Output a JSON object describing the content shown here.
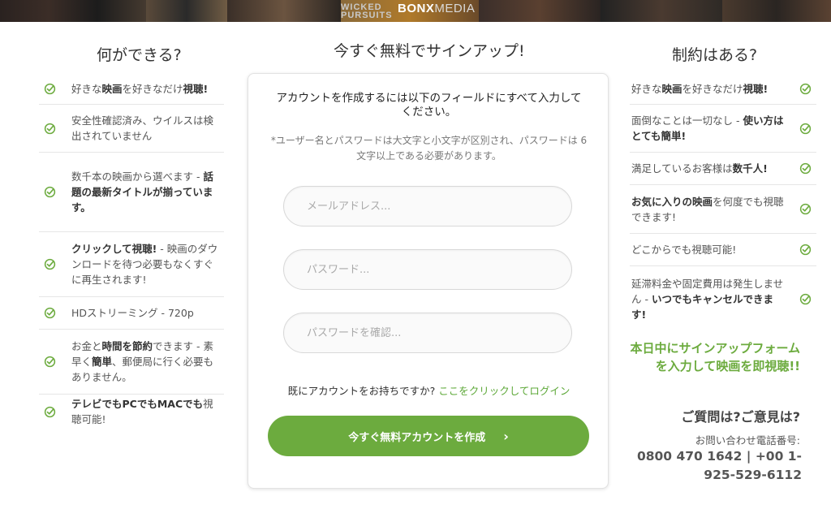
{
  "banner": {
    "brand": "BONX",
    "media": "MEDIA",
    "overlay_line1": "WICKED",
    "overlay_line2": "PURSUITS"
  },
  "left_column": {
    "title": "何ができる?",
    "items": [
      {
        "parts": [
          {
            "t": "好きな",
            "b": false
          },
          {
            "t": "映画",
            "b": true
          },
          {
            "t": "を好きなだけ",
            "b": false
          },
          {
            "t": "視聴!",
            "b": true
          }
        ]
      },
      {
        "parts": [
          {
            "t": "安全性確認済み、ウイルスは検出されていません",
            "b": false
          }
        ]
      },
      {
        "parts": [
          {
            "t": "数千本の映画から選べます - ",
            "b": false
          },
          {
            "t": "話題の最新タイトルが揃っています。",
            "b": true
          }
        ]
      },
      {
        "parts": [
          {
            "t": "クリックして視聴!",
            "b": true
          },
          {
            "t": " - 映画のダウンロードを待つ必要もなくすぐに再生されます!",
            "b": false
          }
        ]
      },
      {
        "parts": [
          {
            "t": "HDストリーミング - 720p",
            "b": false
          }
        ]
      },
      {
        "parts": [
          {
            "t": "お金と",
            "b": false
          },
          {
            "t": "時間を節約",
            "b": true
          },
          {
            "t": "できます - 素早く",
            "b": false
          },
          {
            "t": "簡単",
            "b": true
          },
          {
            "t": "、郵便局に行く必要もありません。",
            "b": false
          }
        ]
      },
      {
        "parts": [
          {
            "t": "テレビでもPCでもMACでも",
            "b": true
          },
          {
            "t": "視聴可能!",
            "b": false
          }
        ]
      }
    ]
  },
  "center": {
    "title": "今すぐ無料でサインアップ!",
    "heading": "アカウントを作成するには以下のフィールドにすべて入力してください。",
    "note": "*ユーザー名とパスワードは大文字と小文字が区別され、パスワードは 6 文字以上である必要があります。",
    "email_placeholder": "メールアドレス...",
    "password_placeholder": "パスワード...",
    "confirm_placeholder": "パスワードを確認...",
    "login_prompt": "既にアカウントをお持ちですか?",
    "login_link": "ここをクリックしてログイン",
    "cta_label": "今すぐ無料アカウントを作成",
    "cta_arrow": "›"
  },
  "right_column": {
    "title": "制約はある?",
    "items": [
      {
        "parts": [
          {
            "t": "好きな",
            "b": false
          },
          {
            "t": "映画",
            "b": true
          },
          {
            "t": "を好きなだけ",
            "b": false
          },
          {
            "t": "視聴!",
            "b": true
          }
        ]
      },
      {
        "parts": [
          {
            "t": "面倒なことは一切なし - ",
            "b": false
          },
          {
            "t": "使い方はとても簡単!",
            "b": true
          }
        ]
      },
      {
        "parts": [
          {
            "t": "満足しているお客様は",
            "b": false
          },
          {
            "t": "数千人!",
            "b": true
          }
        ]
      },
      {
        "parts": [
          {
            "t": "お気に入りの映画",
            "b": true
          },
          {
            "t": "を何度でも視聴できます!",
            "b": false
          }
        ]
      },
      {
        "parts": [
          {
            "t": "どこからでも視聴可能!",
            "b": false
          }
        ]
      },
      {
        "parts": [
          {
            "t": "延滞料金や固定費用は発生しません - ",
            "b": false
          },
          {
            "t": "いつでもキャンセルできます!",
            "b": true
          }
        ]
      }
    ],
    "promo": "本日中にサインアップフォームを入力して映画を即視聴!!",
    "question": "ご質問は?ご意見は?",
    "phone_label": "お問い合わせ電話番号:",
    "phone_number": "0800 470 1642 | +00 1-925-529-6112"
  },
  "colors": {
    "accent_green": "#6cab3e",
    "link_green": "#5da838",
    "banner_bg": "#1a1a1a"
  },
  "icons": {
    "check": "check-circle-icon"
  }
}
